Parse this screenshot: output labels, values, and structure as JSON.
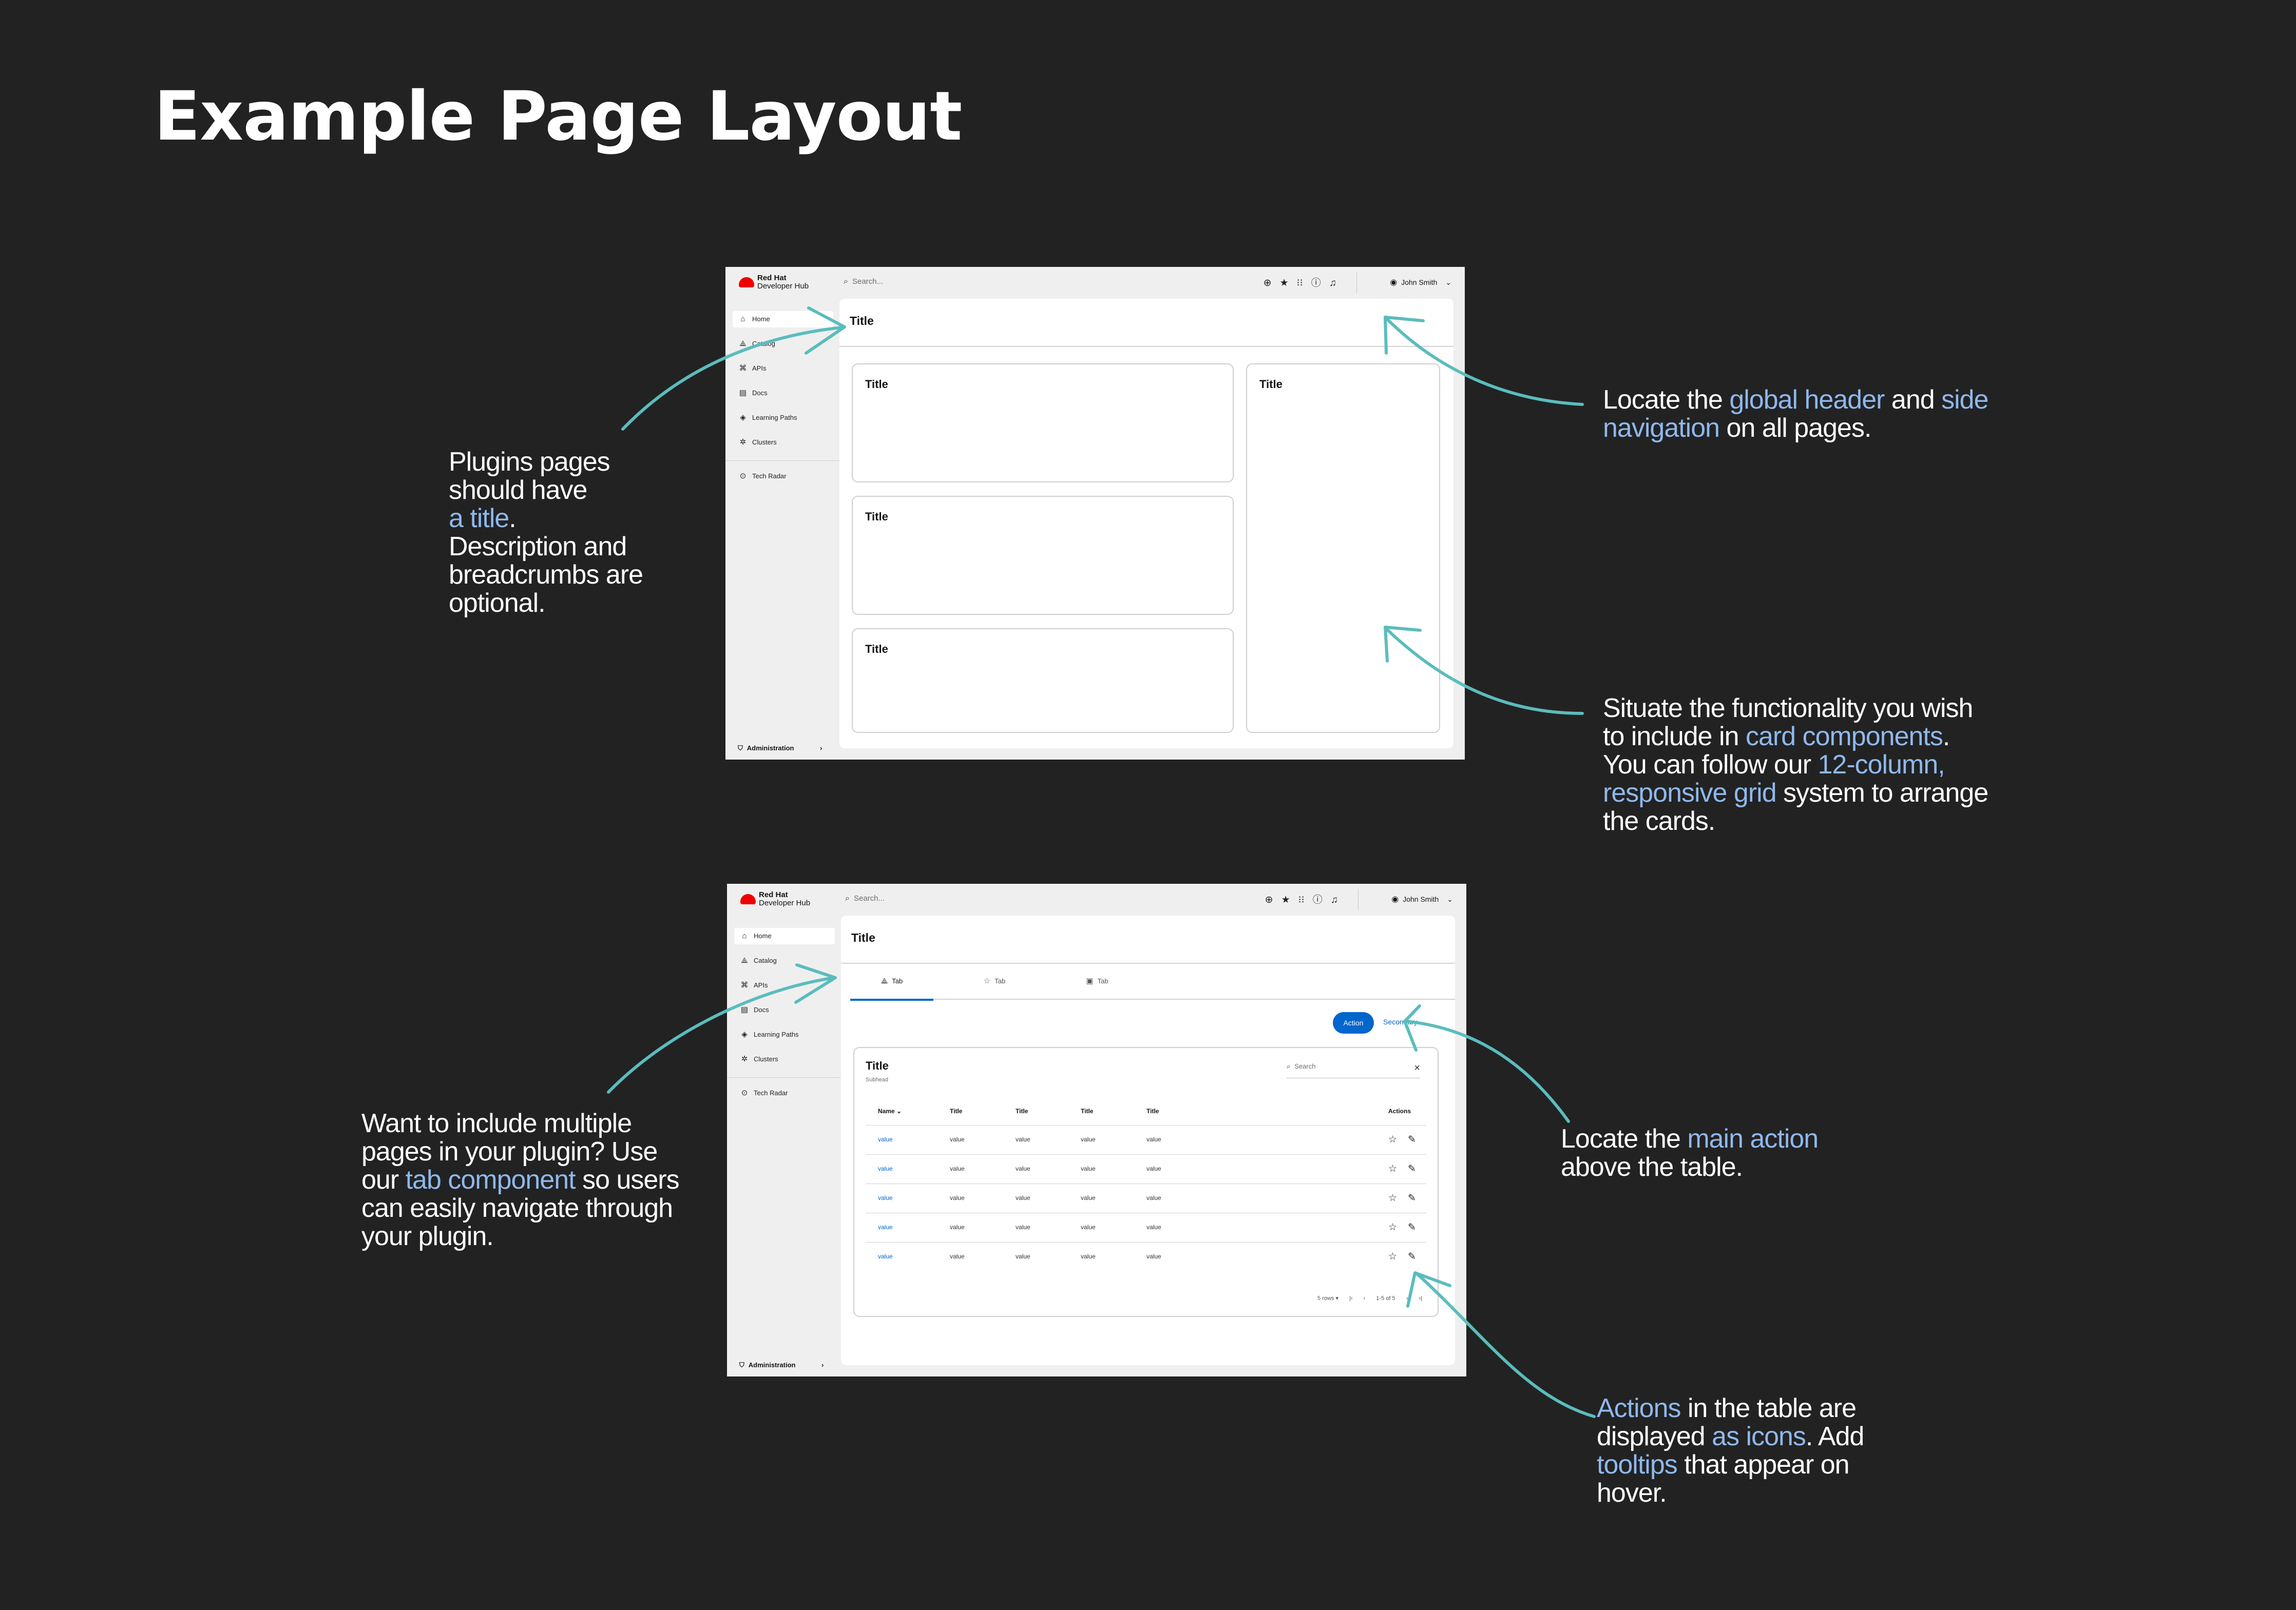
{
  "title": "Example Page Layout",
  "annotation_color": "#8fb8ec",
  "arrow_color": "#5bbcbd",
  "brand_color": "#ee0000",
  "primary_color": "#0066cc",
  "notes": {
    "title_note": [
      "Plugins pages ",
      "should have ",
      "a title",
      ". ",
      "Description and ",
      "breadcrumbs are ",
      "optional."
    ],
    "header_note": [
      "Locate the ",
      "global header",
      " and ",
      "side ",
      "navigation",
      " on all pages."
    ],
    "cards_note": [
      "Situate the functionality you wish ",
      "to include in ",
      "card components",
      ". ",
      "You can follow our ",
      "12-column, ",
      "responsive grid",
      " system to arrange ",
      "the cards."
    ],
    "tabs_note": [
      "Want to include multiple ",
      "pages in your plugin? Use ",
      "our ",
      "tab component",
      " so users ",
      "can easily navigate through ",
      "your plugin."
    ],
    "action_note": [
      "Locate the ",
      "main action",
      " ",
      "above the table."
    ],
    "icons_note": [
      "Actions",
      " in the table are ",
      "displayed ",
      "as icons",
      ". Add ",
      "tooltips",
      " that appear on ",
      "hover."
    ]
  },
  "mockup": {
    "logo": {
      "line1": "Red Hat",
      "line2": "Developer Hub"
    },
    "search_placeholder": "Search...",
    "header_icons": [
      "add-icon",
      "star-icon",
      "apps-grid-icon",
      "help-icon",
      "bell-icon"
    ],
    "user_name": "John Smith",
    "nav": [
      {
        "label": "Home",
        "icon": "home-icon"
      },
      {
        "label": "Catalog",
        "icon": "catalog-icon"
      },
      {
        "label": "APIs",
        "icon": "apis-icon"
      },
      {
        "label": "Docs",
        "icon": "docs-icon"
      },
      {
        "label": "Learning Paths",
        "icon": "learning-paths-icon"
      },
      {
        "label": "Clusters",
        "icon": "clusters-icon"
      },
      {
        "label": "Tech Radar",
        "icon": "tech-radar-icon"
      }
    ],
    "admin_label": "Administration",
    "page_title": "Title",
    "card_titles": [
      "Title",
      "Title",
      "Title",
      "Title"
    ],
    "tabs": [
      "Tab",
      "Tab",
      "Tab"
    ],
    "action_label": "Action",
    "secondary_label": "Secondary",
    "table": {
      "title": "Title",
      "subhead": "Subhead",
      "search_placeholder": "Search",
      "columns": [
        "Name",
        "Title",
        "Title",
        "Title",
        "Title"
      ],
      "actions_header": "Actions",
      "rows": [
        [
          "value",
          "value",
          "value",
          "value",
          "value"
        ],
        [
          "value",
          "value",
          "value",
          "value",
          "value"
        ],
        [
          "value",
          "value",
          "value",
          "value",
          "value"
        ],
        [
          "value",
          "value",
          "value",
          "value",
          "value"
        ],
        [
          "value",
          "value",
          "value",
          "value",
          "value"
        ]
      ],
      "pagination": {
        "rows_per_page": "5 rows",
        "range": "1-5 of 5"
      }
    }
  }
}
